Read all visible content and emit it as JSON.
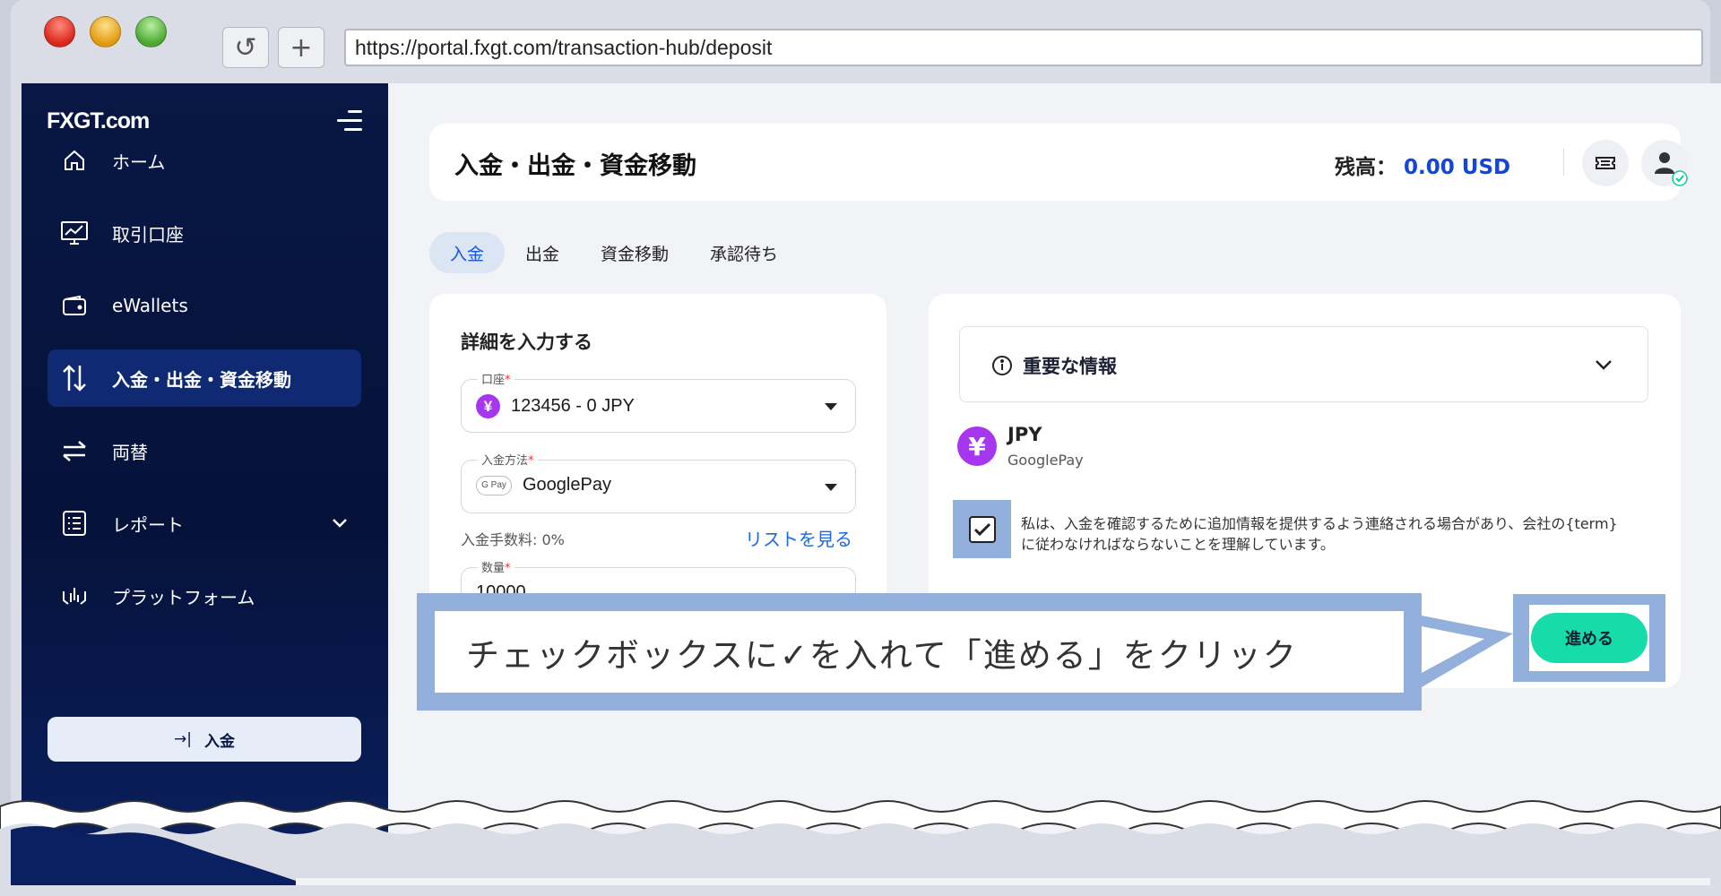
{
  "browser": {
    "url": "https://portal.fxgt.com/transaction-hub/deposit",
    "reload_icon": "↺",
    "new_tab_icon": "+"
  },
  "sidebar": {
    "logo": "FXGT.com",
    "items": [
      {
        "label": "ホーム",
        "icon": "home-icon"
      },
      {
        "label": "取引口座",
        "icon": "chart-monitor-icon"
      },
      {
        "label": "eWallets",
        "icon": "wallet-icon"
      },
      {
        "label": "入金・出金・資金移動",
        "icon": "transfer-arrows-icon",
        "active": true
      },
      {
        "label": "両替",
        "icon": "exchange-icon"
      },
      {
        "label": "レポート",
        "icon": "report-list-icon"
      },
      {
        "label": "プラットフォーム",
        "icon": "platform-icon"
      }
    ],
    "deposit_button": "入金",
    "deposit_button_icon": "→|"
  },
  "header": {
    "title": "入金・出金・資金移動",
    "balance_label": "残高：",
    "balance_value": "0.00 USD"
  },
  "tabs": [
    "入金",
    "出金",
    "資金移動",
    "承認待ち"
  ],
  "form": {
    "title": "詳細を入力する",
    "account_label": "口座",
    "account_value": "123456 - 0 JPY",
    "method_label": "入金方法",
    "method_value": "GooglePay",
    "method_badge": "G Pay",
    "fee_text": "入金手数料: 0%",
    "list_link": "リストを見る",
    "amount_label": "数量",
    "amount_value": "10000",
    "required_mark": "*",
    "currency_symbol": "¥"
  },
  "right": {
    "info_title": "重要な情報",
    "currency": "JPY",
    "method": "GooglePay",
    "terms": "私は、入金を確認するために追加情報を提供するよう連絡される場合があり、会社の{term}に従わなければならないことを理解しています。",
    "checkbox_checked": true,
    "proceed_button": "進める"
  },
  "callout": {
    "text": "チェックボックスに✓を入れて「進める」をクリック"
  },
  "colors": {
    "sidebar": "#081745",
    "accent": "#1246d6",
    "proceed": "#16dcaa",
    "highlight": "#93b0dc",
    "currency": "#a736f0"
  }
}
